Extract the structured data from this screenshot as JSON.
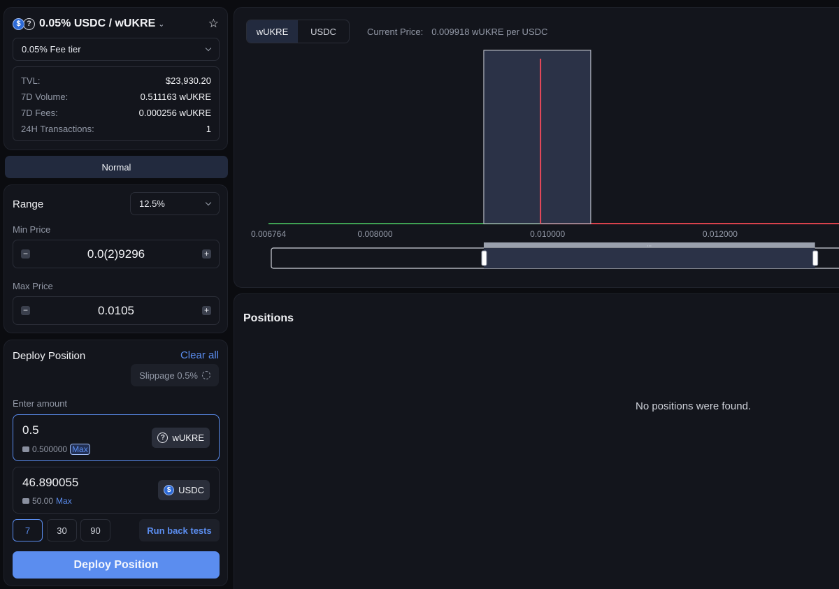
{
  "pool": {
    "token_a_icon": "$",
    "token_b_icon": "?",
    "title": "0.05% USDC / wUKRE",
    "fee_tier": "0.05% Fee tier",
    "stats": [
      {
        "label": "TVL:",
        "value": "$23,930.20"
      },
      {
        "label": "7D Volume:",
        "value": "0.511163 wUKRE"
      },
      {
        "label": "7D Fees:",
        "value": "0.000256 wUKRE"
      },
      {
        "label": "24H Transactions:",
        "value": "1"
      }
    ]
  },
  "mode": {
    "label": "Normal"
  },
  "range": {
    "title": "Range",
    "preset": "12.5%",
    "min_label": "Min Price",
    "min_value": "0.0(2)9296",
    "max_label": "Max Price",
    "max_value": "0.0105",
    "minus": "−",
    "plus": "+"
  },
  "deploy": {
    "title": "Deploy Position",
    "clear_all": "Clear all",
    "slippage": "Slippage 0.5%",
    "enter_amount": "Enter amount",
    "amount_a": {
      "value": "0.5",
      "balance": "0.500000",
      "max": "Max",
      "token": "wUKRE",
      "icon": "?"
    },
    "amount_b": {
      "value": "46.890055",
      "balance": "50.00",
      "max": "Max",
      "token": "USDC",
      "icon": "$"
    },
    "days": [
      "7",
      "30",
      "90"
    ],
    "selected_day": "7",
    "backtest": "Run back tests",
    "deploy_button": "Deploy Position"
  },
  "chart": {
    "toggle": [
      "wUKRE",
      "USDC"
    ],
    "active_toggle": "wUKRE",
    "current_price_label": "Current Price:",
    "current_price_value": "0.009918 wUKRE per USDC"
  },
  "chart_data": {
    "type": "bar",
    "xlim": [
      0.006764,
      0.0135
    ],
    "x_ticks": [
      "0.006764",
      "0.008000",
      "0.010000",
      "0.012000"
    ],
    "tick_values": [
      0.006764,
      0.008,
      0.01,
      0.012
    ],
    "bar": {
      "x0": 0.00926,
      "x1": 0.0105
    },
    "current_price": 0.009918,
    "brush": {
      "x0": 0.00926,
      "x1": 0.0131
    },
    "colors": {
      "below": "#3fa153",
      "above": "#d9424c",
      "bar": "#2b3247",
      "price_line": "#e8485a"
    }
  },
  "positions": {
    "title": "Positions",
    "empty": "No positions were found."
  }
}
